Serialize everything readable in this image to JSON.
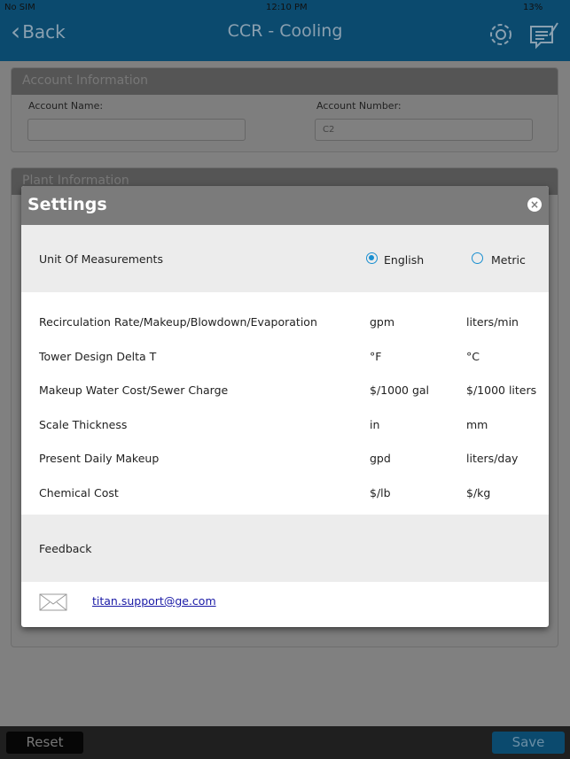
{
  "status_bar": {
    "carrier": "No SIM",
    "time": "12:10 PM",
    "battery": "13%"
  },
  "nav": {
    "back_label": "Back",
    "title": "CCR - Cooling",
    "icons": [
      "settings-gear-icon",
      "notes-edit-icon"
    ]
  },
  "account": {
    "header": "Account Information",
    "name_label": "Account Name:",
    "name_value": "",
    "number_label": "Account Number:",
    "number_value": "C2"
  },
  "plant": {
    "header": "Plant Information"
  },
  "settings": {
    "title": "Settings",
    "unit_label": "Unit Of Measurements",
    "options": [
      {
        "label": "English",
        "selected": true
      },
      {
        "label": "Metric",
        "selected": false
      }
    ],
    "rows": [
      {
        "label": "Recirculation Rate/Makeup/Blowdown/Evaporation",
        "english": "gpm",
        "metric": "liters/min"
      },
      {
        "label": "Tower Design Delta T",
        "english": "°F",
        "metric": "°C"
      },
      {
        "label": "Makeup Water Cost/Sewer Charge",
        "english": "$/1000 gal",
        "metric": "$/1000 liters"
      },
      {
        "label": "Scale Thickness",
        "english": "in",
        "metric": "mm"
      },
      {
        "label": "Present Daily Makeup",
        "english": "gpd",
        "metric": "liters/day"
      },
      {
        "label": "Chemical Cost",
        "english": "$/lb",
        "metric": "$/kg"
      }
    ],
    "feedback_label": "Feedback",
    "email": "titan.support@ge.com"
  },
  "footer": {
    "reset_label": "Reset",
    "save_label": "Save"
  },
  "colors": {
    "nav": "#0b4a6e",
    "accent": "#1a8fd0",
    "save": "#0b4a6e"
  }
}
